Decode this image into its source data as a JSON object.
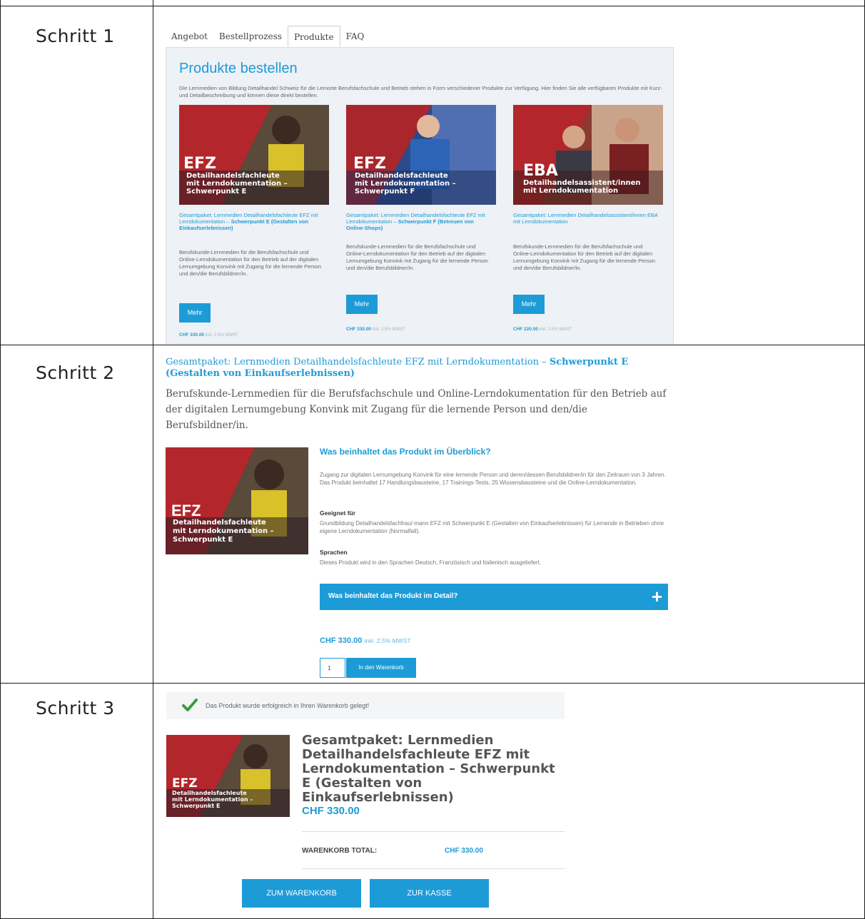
{
  "steps": {
    "s1": "Schritt 1",
    "s2": "Schritt 2",
    "s3": "Schritt 3"
  },
  "tabs": [
    "Angebot",
    "Bestellprozess",
    "Produkte",
    "FAQ"
  ],
  "catalog": {
    "title": "Produkte bestellen",
    "intro": "Die Lernmedien von Bildung Detailhandel Schweiz für die Lernorte Berufsfachschule und Betrieb stehen in Form verschiedener Produkte zur Verfügung. Hier finden Sie alle verfügbaren Produkte mit Kurz- und Detailbeschreibung und können diese direkt bestellen.",
    "cards": [
      {
        "badge": "EFZ",
        "overlay_lines": [
          "Detailhandelsfachleute",
          "mit Lerndokumentation –",
          "Schwerpunkt E"
        ],
        "title_plain": "Gesamtpaket: Lernmedien Detailhandelsfachleute EFZ mit Lerndokumentation –",
        "title_bold": "Schwerpunkt E (Gestalten von Einkaufserlebnissen)",
        "desc": "Berufskunde-Lernmedien für die Berufsfachschule und Online-Lerndokumentation für den Betrieb auf der digitalen Lernumgebung Konvink mit Zugang für die lernende Person und den/die Berufsbildner/in.",
        "button": "Mehr",
        "price": "CHF 330.00",
        "vat": "inkl. 2.5% MWST"
      },
      {
        "badge": "EFZ",
        "overlay_lines": [
          "Detailhandelsfachleute",
          "mit Lerndokumentation –",
          "Schwerpunkt F"
        ],
        "title_plain": "Gesamtpaket: Lernmedien Detailhandelsfachleute EFZ mit Lerndokumentation –",
        "title_bold": "Schwerpunkt F (Betreuen von Online-Shops)",
        "desc": "Berufskunde-Lernmedien für die Berufsfachschule und Online-Lerndokumentation für den Betrieb auf der digitalen Lernumgebung Konvink mit Zugang für die lernende Person und den/die Berufsbildner/in.",
        "button": "Mehr",
        "price": "CHF 330.00",
        "vat": "inkl. 2.5% MWST"
      },
      {
        "badge": "EBA",
        "overlay_lines": [
          "Detailhandelsassistent/innen",
          "mit Lerndokumentation"
        ],
        "title_plain": "Gesamtpaket: Lernmedien Detailhandelsassistent/innen EBA mit Lerndokumentation",
        "title_bold": "",
        "desc": "Berufskunde-Lernmedien für die Berufsfachschule und Online-Lerndokumentation für den Betrieb auf der digitalen Lernumgebung Konvink mit Zugang für die lernende Person und den/die Berufsbildner/in.",
        "button": "Mehr",
        "price": "CHF 220.00",
        "vat": "inkl. 2.5% MWST"
      }
    ]
  },
  "detail": {
    "title_plain": "Gesamtpaket: Lernmedien Detailhandelsfachleute EFZ mit Lerndokumentation –",
    "title_bold": "Schwerpunkt E (Gestalten von Einkaufserlebnissen)",
    "subtitle": "Berufskunde-Lernmedien für die Berufsfachschule und Online-Lerndokumentation für den Betrieb auf der digitalen Lernumgebung Konvink mit Zugang für die lernende Person und den/die Berufsbildner/in.",
    "overview_heading": "Was beinhaltet das Produkt im Überblick?",
    "overview_text": "Zugang zur digitalen Lernumgebung Konvink für eine lernende Person und deren/dessen Berufsbildner/in für den Zeitraum von 3 Jahren. Das Produkt beinhaltet 17 Handlungsbausteine, 17 Trainings-Tests, 25 Wissensbausteine und die Online-Lerndokumentation.",
    "suitable_label": "Geeignet für",
    "suitable_text": "Grundbildung Detailhandelsfachfrau/-mann EFZ mit Schwerpunkt E (Gestalten von Einkaufserlebnissen) für Lernende in Betrieben ohne eigene Lerndokumentation (Normalfall).",
    "lang_label": "Sprachen",
    "lang_text": "Dieses Produkt wird in den Sprachen Deutsch, Französisch und Italienisch ausgeliefert.",
    "accordion_label": "Was beinhaltet das Produkt im Detail?",
    "accordion_icon": "+",
    "price": "CHF 330.00",
    "vat": "inkl. 2.5% MWST",
    "quantity": "1",
    "add_to_cart": "In den Warenkorb"
  },
  "cart": {
    "notice": "Das Produkt wurde erfolgreich in Ihren Warenkorb gelegt!",
    "product_title": "Gesamtpaket: Lernmedien Detailhandelsfachleute EFZ mit Lerndokumentation – Schwerpunkt E (Gestalten von Einkaufserlebnissen)",
    "price": "CHF 330.00",
    "total_label": "WARENKORB TOTAL:",
    "total_value": "CHF 330.00",
    "btn_cart": "ZUM WARENKORB",
    "btn_checkout": "ZUR KASSE"
  },
  "colors": {
    "accent": "#1d9bd7",
    "success": "#3c9b3c",
    "panel": "#eef1f5"
  },
  "icons": {
    "check": "check-icon",
    "plus": "plus-icon"
  }
}
